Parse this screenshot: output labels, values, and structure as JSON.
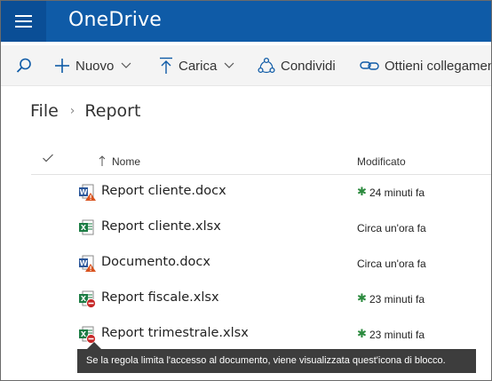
{
  "app": {
    "title": "OneDrive"
  },
  "toolbar": {
    "new_label": "Nuovo",
    "upload_label": "Carica",
    "share_label": "Condividi",
    "link_label": "Ottieni collegamento"
  },
  "breadcrumb": {
    "root": "File",
    "current": "Report"
  },
  "table": {
    "col_name": "Nome",
    "col_modified": "Modificato",
    "rows": [
      {
        "name": "Report cliente.docx",
        "modified": "24 minuti fa",
        "icon": "word-warning-icon",
        "starred": true
      },
      {
        "name": "Report cliente.xlsx",
        "modified": "Circa un'ora fa",
        "icon": "excel-icon",
        "starred": false
      },
      {
        "name": "Documento.docx",
        "modified": "Circa un'ora fa",
        "icon": "word-warning-icon",
        "starred": false
      },
      {
        "name": "Report fiscale.xlsx",
        "modified": "23 minuti fa",
        "icon": "excel-blocked-icon",
        "starred": true
      },
      {
        "name": "Report trimestrale.xlsx",
        "modified": "23 minuti fa",
        "icon": "excel-blocked-icon",
        "starred": true
      }
    ]
  },
  "tooltip": {
    "text": "Se la regola limita l'accesso al documento, viene visualizzata quest'icona di blocco."
  },
  "colors": {
    "topbar": "#0f5ba7",
    "accent": "#0f5ba7",
    "excel": "#1d7d45",
    "word": "#2b579a",
    "new_star": "#2b8a3e",
    "block": "#c62828"
  }
}
